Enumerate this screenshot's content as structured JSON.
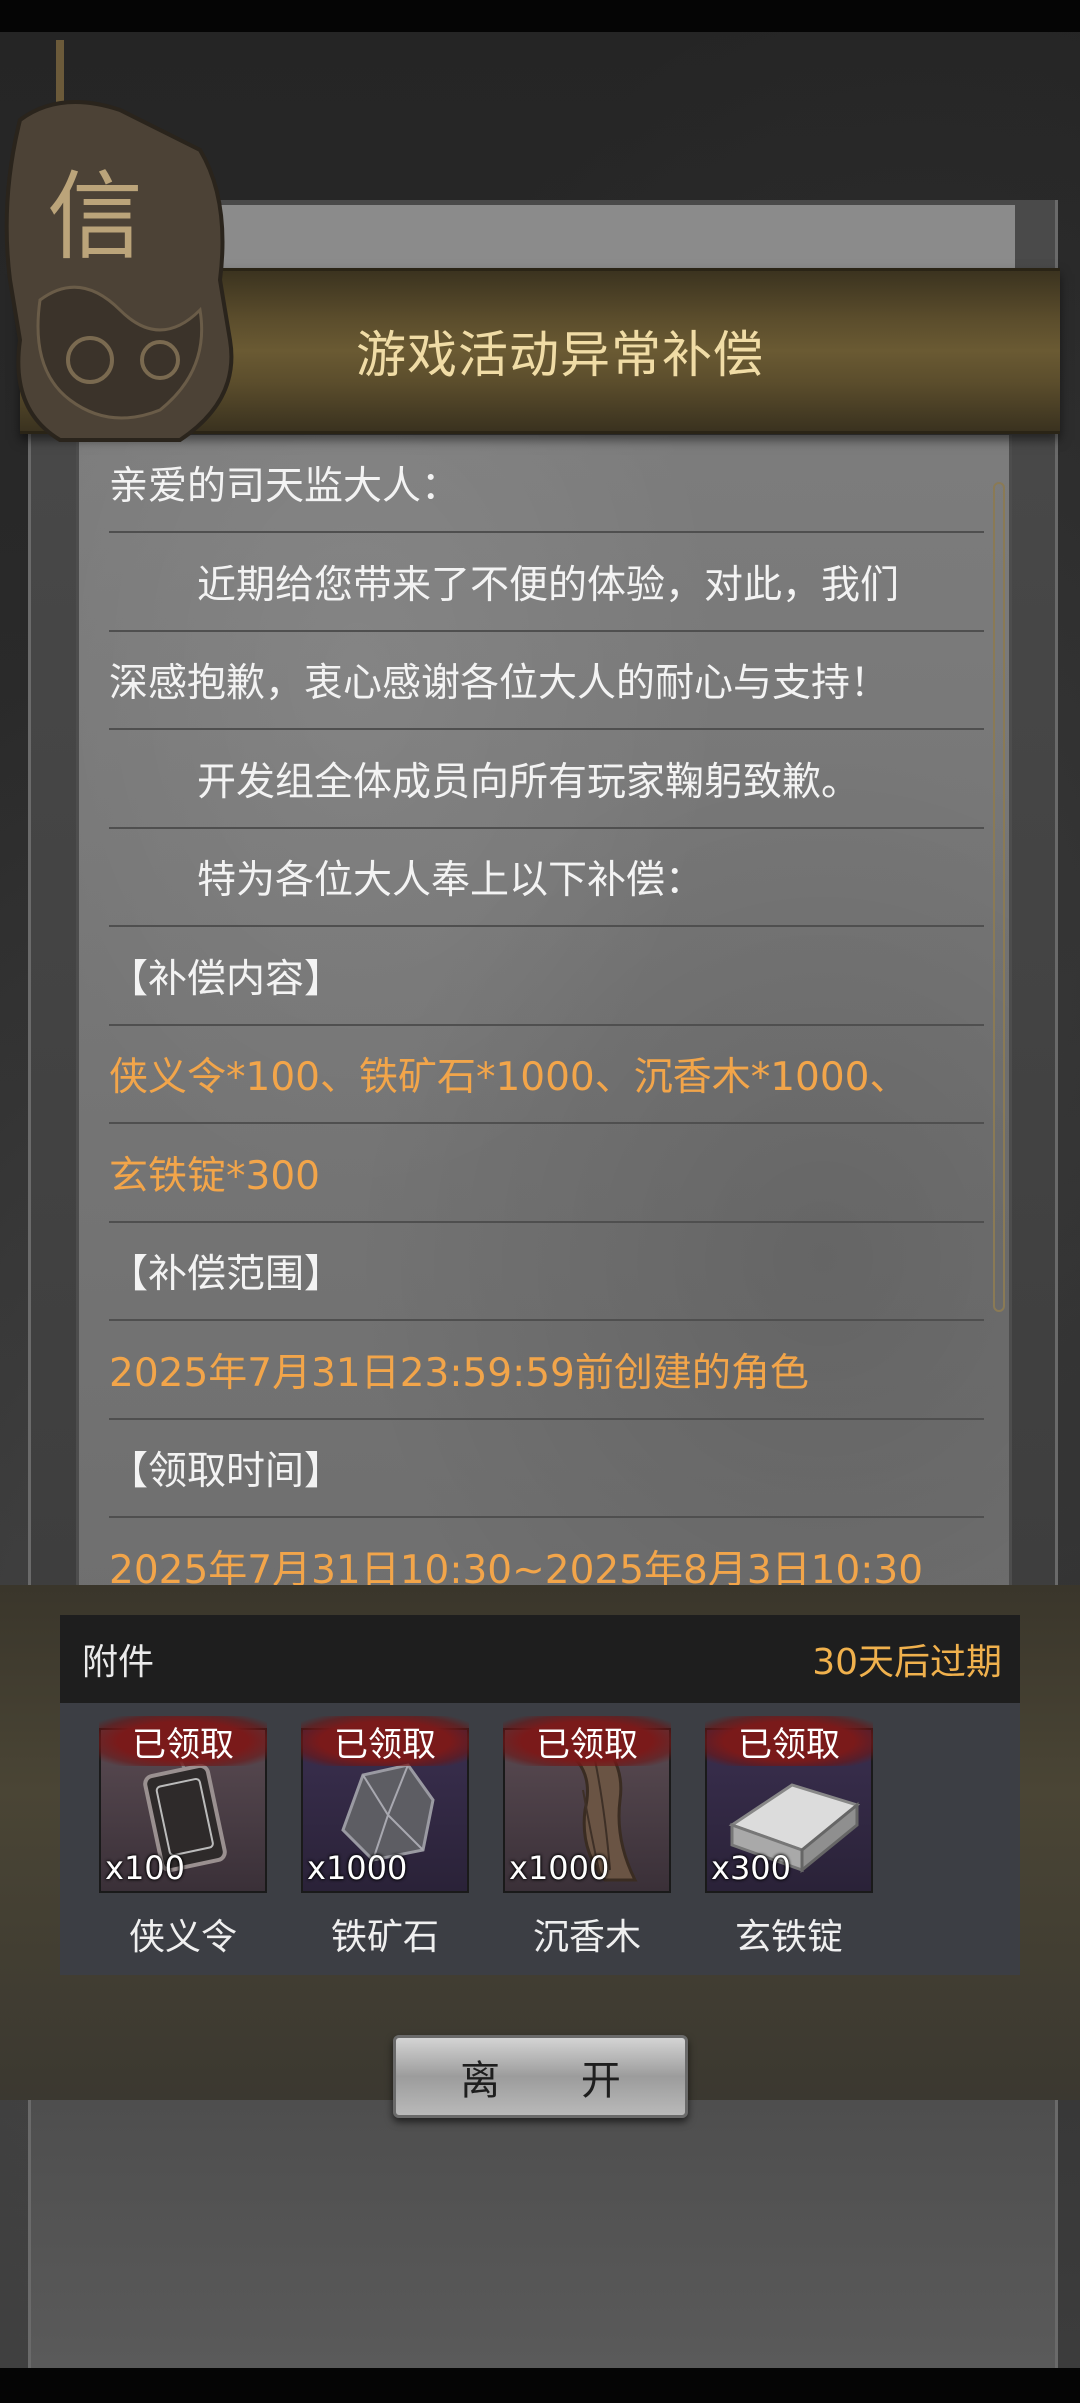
{
  "mail": {
    "title": "游戏活动异常补偿",
    "seal_char": "信",
    "lines": [
      {
        "text": "亲爱的司天监大人：",
        "indent": false,
        "highlight": false
      },
      {
        "text": "近期给您带来了不便的体验，对此，我们",
        "indent": true,
        "highlight": false
      },
      {
        "text": "深感抱歉，衷心感谢各位大人的耐心与支持！",
        "indent": false,
        "highlight": false
      },
      {
        "text": "开发组全体成员向所有玩家鞠躬致歉。",
        "indent": true,
        "highlight": false
      },
      {
        "text": "特为各位大人奉上以下补偿：",
        "indent": true,
        "highlight": false
      },
      {
        "text": "【补偿内容】",
        "indent": false,
        "highlight": false
      },
      {
        "text": "侠义令*100、铁矿石*1000、沉香木*1000、",
        "indent": false,
        "highlight": true
      },
      {
        "text": "玄铁锭*300",
        "indent": false,
        "highlight": true
      },
      {
        "text": "【补偿范围】",
        "indent": false,
        "highlight": false
      },
      {
        "text": "2025年7月31日23:59:59前创建的角色",
        "indent": false,
        "highlight": true
      },
      {
        "text": "【领取时间】",
        "indent": false,
        "highlight": false
      },
      {
        "text": "2025年7月31日10:30~2025年8月3日10:30",
        "indent": false,
        "highlight": true
      }
    ]
  },
  "attachments": {
    "label": "附件",
    "expire_text": "30天后过期",
    "claimed_label": "已领取",
    "items": [
      {
        "name": "侠义令",
        "qty": "x100",
        "icon": "token-plaque-icon"
      },
      {
        "name": "铁矿石",
        "qty": "x1000",
        "icon": "iron-ore-icon"
      },
      {
        "name": "沉香木",
        "qty": "x1000",
        "icon": "agarwood-icon"
      },
      {
        "name": "玄铁锭",
        "qty": "x300",
        "icon": "iron-ingot-icon"
      }
    ]
  },
  "leave_button": "离 开",
  "colors": {
    "highlight": "#f2a54a",
    "banner_text": "#f0dca6",
    "expire": "#f0b14d",
    "claimed_badge": "#7a1a1a"
  }
}
